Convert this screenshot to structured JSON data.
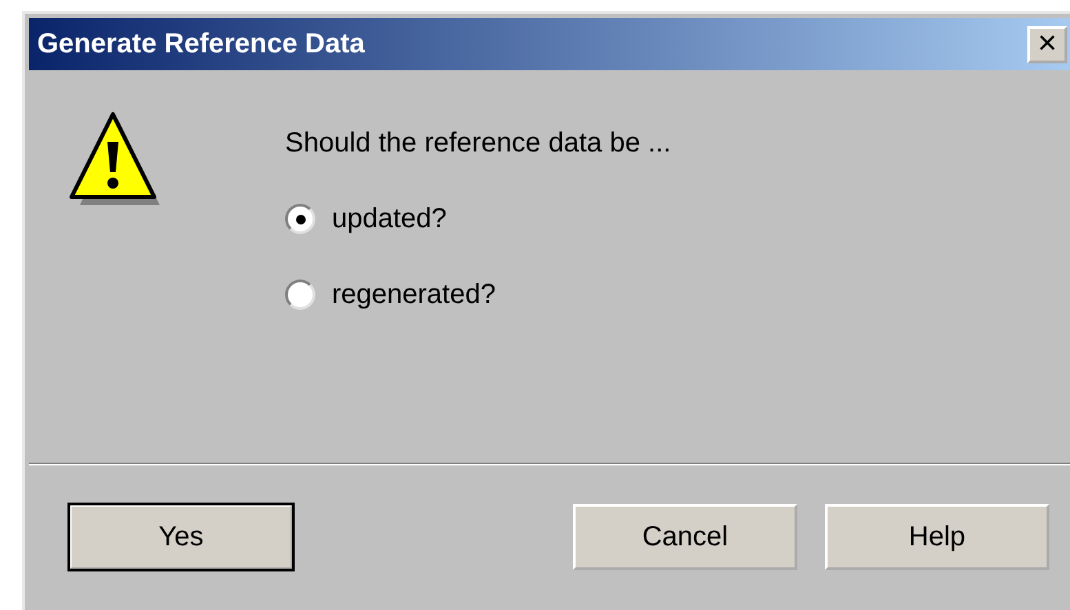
{
  "window": {
    "title": "Generate Reference Data",
    "close": "×"
  },
  "message": "Should the reference data be ...",
  "options": [
    {
      "label": "updated?",
      "selected": true
    },
    {
      "label": "regenerated?",
      "selected": false
    }
  ],
  "buttons": [
    {
      "label": "Yes",
      "default": true
    },
    {
      "label": "Cancel",
      "default": false
    },
    {
      "label": "Help",
      "default": false
    }
  ]
}
